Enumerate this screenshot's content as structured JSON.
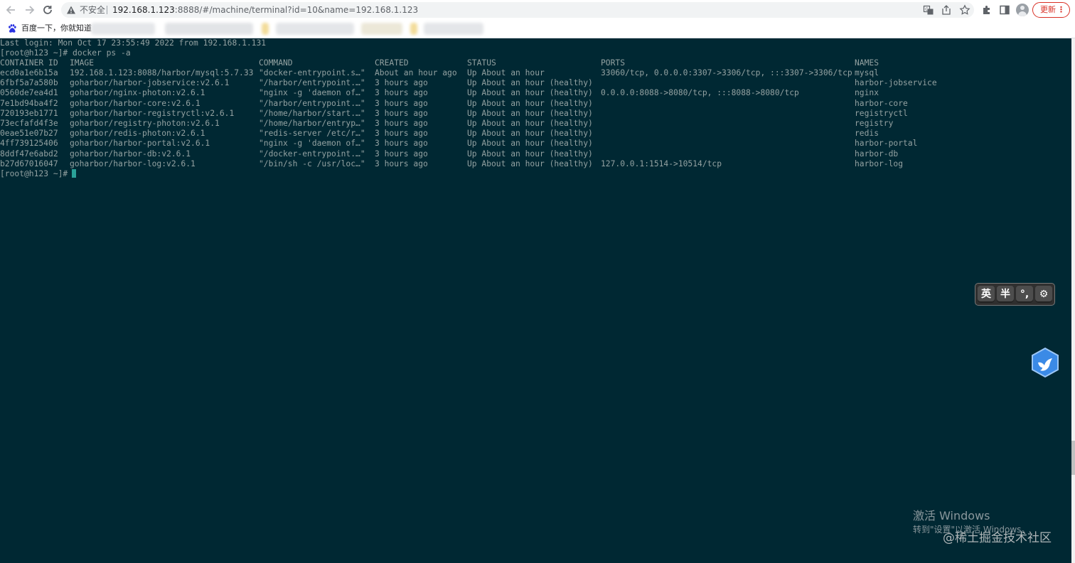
{
  "browser": {
    "insecure_label": "不安全",
    "url_host": "192.168.1.123",
    "url_rest": ":8888/#/machine/terminal?id=10&name=192.168.1.123",
    "update_label": "更新",
    "update_menu": "⋮",
    "bookmark_label": "百度一下，你就知道",
    "icons": [
      "back-icon",
      "forward-icon",
      "reload-icon",
      "warning-icon",
      "translate-icon",
      "share-icon",
      "star-icon",
      "extensions-icon",
      "side-panel-icon",
      "profile-icon"
    ]
  },
  "terminal": {
    "last_login": "Last login: Mon Oct 17 23:55:49 2022 from 192.168.1.131",
    "command_line": "[root@h123 ~]# docker ps -a",
    "prompt": "[root@h123 ~]#",
    "columns": [
      "CONTAINER ID",
      "IMAGE",
      "COMMAND",
      "CREATED",
      "STATUS",
      "PORTS",
      "NAMES"
    ],
    "rows": [
      [
        "ecd0a1e6b15a",
        "192.168.1.123:8088/harbor/mysql:5.7.33",
        "\"docker-entrypoint.s…\"",
        "About an hour ago",
        "Up About an hour",
        "33060/tcp, 0.0.0.0:3307->3306/tcp, :::3307->3306/tcp",
        "mysql"
      ],
      [
        "6fbf5a7a580b",
        "goharbor/harbor-jobservice:v2.6.1",
        "\"/harbor/entrypoint.…\"",
        "3 hours ago",
        "Up About an hour (healthy)",
        "",
        "harbor-jobservice"
      ],
      [
        "0560de7ea4d1",
        "goharbor/nginx-photon:v2.6.1",
        "\"nginx -g 'daemon of…\"",
        "3 hours ago",
        "Up About an hour (healthy)",
        "0.0.0.0:8088->8080/tcp, :::8088->8080/tcp",
        "nginx"
      ],
      [
        "7e1bd94ba4f2",
        "goharbor/harbor-core:v2.6.1",
        "\"/harbor/entrypoint.…\"",
        "3 hours ago",
        "Up About an hour (healthy)",
        "",
        "harbor-core"
      ],
      [
        "720193eb1771",
        "goharbor/harbor-registryctl:v2.6.1",
        "\"/home/harbor/start.…\"",
        "3 hours ago",
        "Up About an hour (healthy)",
        "",
        "registryctl"
      ],
      [
        "73ecfafd4f3e",
        "goharbor/registry-photon:v2.6.1",
        "\"/home/harbor/entryp…\"",
        "3 hours ago",
        "Up About an hour (healthy)",
        "",
        "registry"
      ],
      [
        "0eae51e07b27",
        "goharbor/redis-photon:v2.6.1",
        "\"redis-server /etc/r…\"",
        "3 hours ago",
        "Up About an hour (healthy)",
        "",
        "redis"
      ],
      [
        "4ff739125406",
        "goharbor/harbor-portal:v2.6.1",
        "\"nginx -g 'daemon of…\"",
        "3 hours ago",
        "Up About an hour (healthy)",
        "",
        "harbor-portal"
      ],
      [
        "8ddf47e6abd2",
        "goharbor/harbor-db:v2.6.1",
        "\"/docker-entrypoint.…\"",
        "3 hours ago",
        "Up About an hour (healthy)",
        "",
        "harbor-db"
      ],
      [
        "b27d67016047",
        "goharbor/harbor-log:v2.6.1",
        "\"/bin/sh -c /usr/loc…\"",
        "3 hours ago",
        "Up About an hour (healthy)",
        "127.0.0.1:1514->10514/tcp",
        "harbor-log"
      ]
    ]
  },
  "ime": {
    "keys": [
      "英",
      "半",
      "°,",
      "⚙"
    ]
  },
  "watermark": {
    "activate_title": "激活 Windows",
    "activate_sub": "转到\"设置\"以激活 Windows。",
    "site": "@稀土掘金技术社区"
  },
  "colors": {
    "terminal_bg": "#002833",
    "terminal_fg": "#93a1a1",
    "cursor": "#2aa198",
    "update_red": "#d93025"
  }
}
